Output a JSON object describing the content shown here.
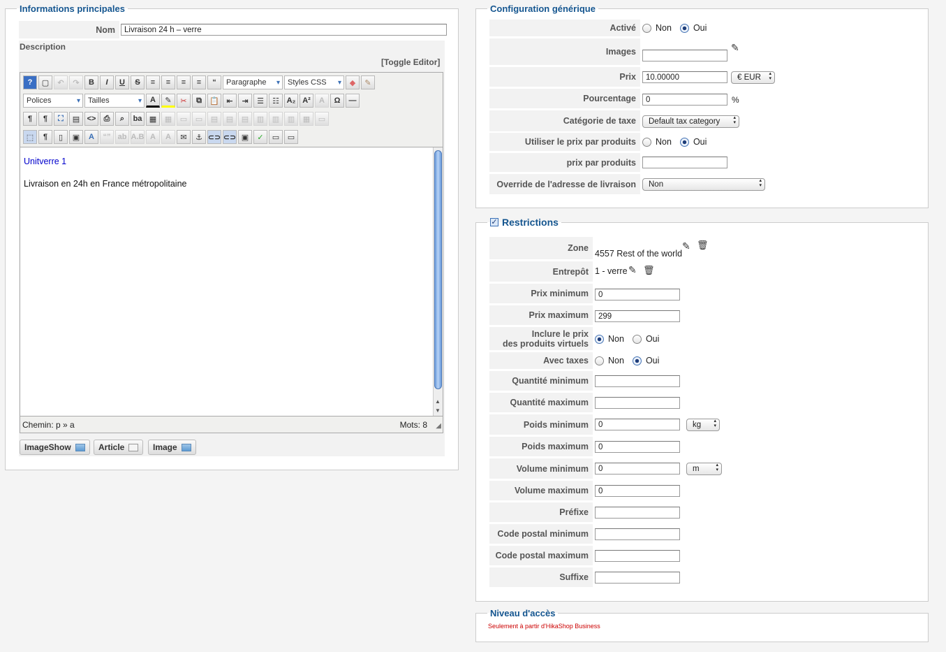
{
  "main": {
    "legend": "Informations principales",
    "name_label": "Nom",
    "name_value": "Livraison 24 h – verre",
    "description_label": "Description",
    "toggle_editor": "[Toggle Editor]",
    "toolbar": {
      "paragraph": "Paragraphe",
      "styles": "Styles CSS",
      "fonts": "Polices",
      "sizes": "Tailles"
    },
    "content_line1": "Unitverre 1",
    "content_line2": "Livraison en 24h en France métropolitaine",
    "status_path": "Chemin: p » a",
    "status_words": "Mots: 8",
    "buttons": [
      "ImageShow",
      "Article",
      "Image"
    ]
  },
  "config": {
    "legend": "Configuration générique",
    "active_label": "Activé",
    "images_label": "Images",
    "price_label": "Prix",
    "price_value": "10.00000",
    "currency": "€ EUR",
    "percent_label": "Pourcentage",
    "percent_value": "0",
    "percent_sign": "%",
    "tax_label": "Catégorie de taxe",
    "tax_value": "Default tax category",
    "use_price_products_label": "Utiliser le prix par produits",
    "price_products_label": "prix par produits",
    "override_label": "Override de l'adresse de livraison",
    "override_value": "Non",
    "no": "Non",
    "yes": "Oui"
  },
  "restrictions": {
    "legend": "Restrictions",
    "zone_label": "Zone",
    "zone_value": "4557 Rest of the world",
    "warehouse_label": "Entrepôt",
    "warehouse_value": "1 - verre",
    "min_price_label": "Prix minimum",
    "min_price_value": "0",
    "max_price_label": "Prix maximum",
    "max_price_value": "299",
    "virtual_label_1": "Inclure le prix",
    "virtual_label_2": "des produits virtuels",
    "taxes_label": "Avec taxes",
    "min_qty_label": "Quantité minimum",
    "max_qty_label": "Quantité maximum",
    "min_weight_label": "Poids minimum",
    "min_weight_value": "0",
    "weight_unit": "kg",
    "max_weight_label": "Poids maximum",
    "max_weight_value": "0",
    "min_volume_label": "Volume minimum",
    "min_volume_value": "0",
    "volume_unit": "m",
    "max_volume_label": "Volume maximum",
    "max_volume_value": "0",
    "prefix_label": "Préfixe",
    "min_postal_label": "Code postal minimum",
    "max_postal_label": "Code postal maximum",
    "suffix_label": "Suffixe"
  },
  "access": {
    "legend": "Niveau d'accès",
    "notice": "Seulement à partir d'HikaShop Business"
  },
  "colors": {
    "legend": "#14558f",
    "link": "#0000cc",
    "notice": "#cc0000"
  }
}
